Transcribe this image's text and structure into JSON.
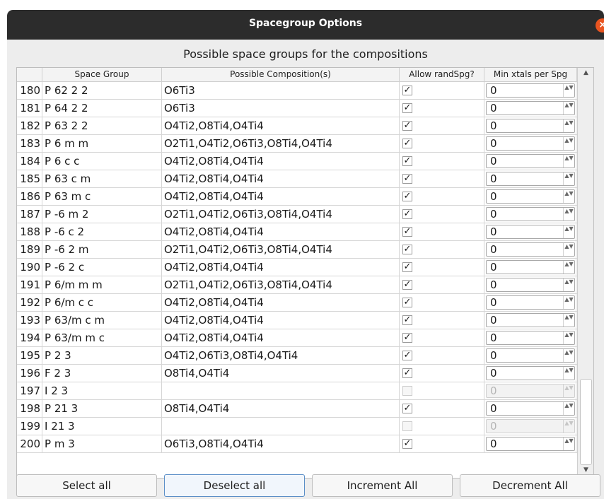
{
  "window": {
    "title": "Spacegroup Options",
    "close_label": "×"
  },
  "heading": "Possible space groups for the compositions",
  "table": {
    "columns": [
      "Space Group",
      "Possible Composition(s)",
      "Allow randSpg?",
      "Min xtals per Spg"
    ],
    "rows": [
      {
        "num": "180",
        "spg": "P 62 2 2",
        "comp": "O6Ti3",
        "allow": "✓",
        "min": "0",
        "enabled": true
      },
      {
        "num": "181",
        "spg": "P 64 2 2",
        "comp": "O6Ti3",
        "allow": "✓",
        "min": "0",
        "enabled": true
      },
      {
        "num": "182",
        "spg": "P 63 2 2",
        "comp": "O4Ti2,O8Ti4,O4Ti4",
        "allow": "✓",
        "min": "0",
        "enabled": true
      },
      {
        "num": "183",
        "spg": "P 6 m m",
        "comp": "O2Ti1,O4Ti2,O6Ti3,O8Ti4,O4Ti4",
        "allow": "✓",
        "min": "0",
        "enabled": true
      },
      {
        "num": "184",
        "spg": "P 6 c c",
        "comp": "O4Ti2,O8Ti4,O4Ti4",
        "allow": "✓",
        "min": "0",
        "enabled": true
      },
      {
        "num": "185",
        "spg": "P 63 c m",
        "comp": "O4Ti2,O8Ti4,O4Ti4",
        "allow": "✓",
        "min": "0",
        "enabled": true
      },
      {
        "num": "186",
        "spg": "P 63 m c",
        "comp": "O4Ti2,O8Ti4,O4Ti4",
        "allow": "✓",
        "min": "0",
        "enabled": true
      },
      {
        "num": "187",
        "spg": "P -6 m 2",
        "comp": "O2Ti1,O4Ti2,O6Ti3,O8Ti4,O4Ti4",
        "allow": "✓",
        "min": "0",
        "enabled": true
      },
      {
        "num": "188",
        "spg": "P -6 c 2",
        "comp": "O4Ti2,O8Ti4,O4Ti4",
        "allow": "✓",
        "min": "0",
        "enabled": true
      },
      {
        "num": "189",
        "spg": "P -6 2 m",
        "comp": "O2Ti1,O4Ti2,O6Ti3,O8Ti4,O4Ti4",
        "allow": "✓",
        "min": "0",
        "enabled": true
      },
      {
        "num": "190",
        "spg": "P -6 2 c",
        "comp": "O4Ti2,O8Ti4,O4Ti4",
        "allow": "✓",
        "min": "0",
        "enabled": true
      },
      {
        "num": "191",
        "spg": "P 6/m m m",
        "comp": "O2Ti1,O4Ti2,O6Ti3,O8Ti4,O4Ti4",
        "allow": "✓",
        "min": "0",
        "enabled": true
      },
      {
        "num": "192",
        "spg": "P 6/m c c",
        "comp": "O4Ti2,O8Ti4,O4Ti4",
        "allow": "✓",
        "min": "0",
        "enabled": true
      },
      {
        "num": "193",
        "spg": "P 63/m c m",
        "comp": "O4Ti2,O8Ti4,O4Ti4",
        "allow": "✓",
        "min": "0",
        "enabled": true
      },
      {
        "num": "194",
        "spg": "P 63/m m c",
        "comp": "O4Ti2,O8Ti4,O4Ti4",
        "allow": "✓",
        "min": "0",
        "enabled": true
      },
      {
        "num": "195",
        "spg": "P 2 3",
        "comp": "O4Ti2,O6Ti3,O8Ti4,O4Ti4",
        "allow": "✓",
        "min": "0",
        "enabled": true
      },
      {
        "num": "196",
        "spg": "F 2 3",
        "comp": "O8Ti4,O4Ti4",
        "allow": "✓",
        "min": "0",
        "enabled": true
      },
      {
        "num": "197",
        "spg": "I 2 3",
        "comp": "",
        "allow": "",
        "min": "0",
        "enabled": false
      },
      {
        "num": "198",
        "spg": "P 21 3",
        "comp": "O8Ti4,O4Ti4",
        "allow": "✓",
        "min": "0",
        "enabled": true
      },
      {
        "num": "199",
        "spg": "I 21 3",
        "comp": "",
        "allow": "",
        "min": "0",
        "enabled": false
      },
      {
        "num": "200",
        "spg": "P m 3",
        "comp": "O6Ti3,O8Ti4,O4Ti4",
        "allow": "✓",
        "min": "0",
        "enabled": true
      }
    ]
  },
  "scrollbar": {
    "up_arrow": "▲",
    "down_arrow": "▼"
  },
  "spin_arrows": "▲▼",
  "buttons": [
    "Select all",
    "Deselect all",
    "Increment All",
    "Decrement All"
  ],
  "colors": {
    "titlebar": "#2c2c2c",
    "close": "#e95420",
    "focus_border": "#5b8fc7"
  }
}
